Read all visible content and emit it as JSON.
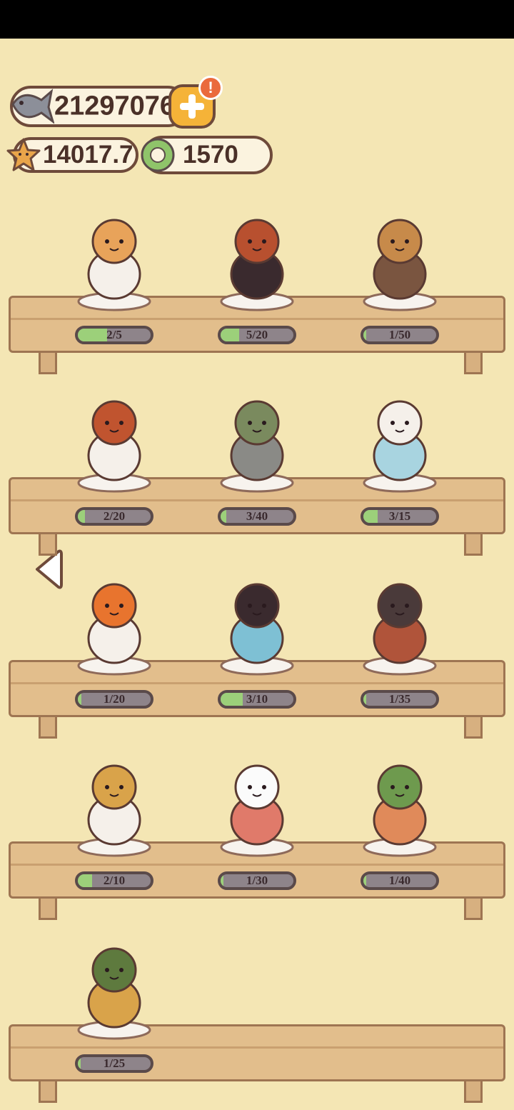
{
  "currency": {
    "fish": "21297076",
    "stars": "14017.7",
    "gems": "1570",
    "alert": "!"
  },
  "icons": {
    "fish": "fish-icon",
    "star": "star-icon",
    "gem": "gem-icon",
    "add": "plus-icon",
    "back": "left-arrow-icon"
  },
  "colors": {
    "background": "#f4e6b4",
    "progress_fill": "#9cd07a",
    "progress_track": "#8e848a",
    "button": "#f5b338",
    "alert": "#ea6a3c"
  },
  "collection": [
    {
      "name": "lucky-cat-drum",
      "progress": "2/5",
      "level": 0.4
    },
    {
      "name": "girl-red-beret",
      "progress": "5/20",
      "level": 0.25
    },
    {
      "name": "dog-heart",
      "progress": "1/50",
      "level": 0.02
    },
    {
      "name": "dog-racecar",
      "progress": "2/20",
      "level": 0.1
    },
    {
      "name": "duck-astronaut",
      "progress": "3/40",
      "level": 0.075
    },
    {
      "name": "goose-kimono",
      "progress": "3/15",
      "level": 0.2
    },
    {
      "name": "fox-staff",
      "progress": "1/20",
      "level": 0.05
    },
    {
      "name": "penguin-tub",
      "progress": "3/10",
      "level": 0.3
    },
    {
      "name": "shiba-uniform",
      "progress": "1/35",
      "level": 0.03
    },
    {
      "name": "bear-god-of-wealth",
      "progress": "2/10",
      "level": 0.2
    },
    {
      "name": "white-dog-bag",
      "progress": "1/30",
      "level": 0.033
    },
    {
      "name": "frog-drink",
      "progress": "1/40",
      "level": 0.025
    },
    {
      "name": "frog-sunglasses",
      "progress": "1/25",
      "level": 0.04
    }
  ]
}
